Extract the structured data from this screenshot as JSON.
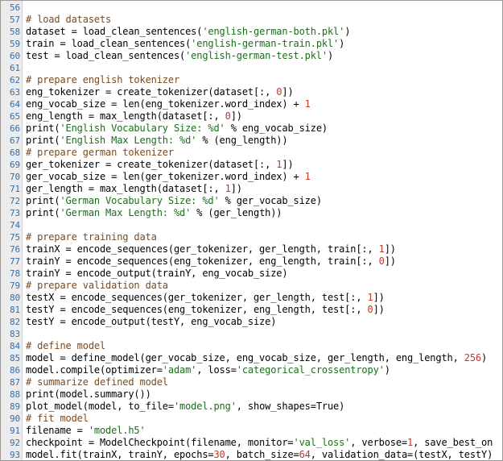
{
  "editor": {
    "lines": [
      {
        "no": "56",
        "tokens": []
      },
      {
        "no": "57",
        "tokens": [
          {
            "t": "# load datasets",
            "k": "c"
          }
        ]
      },
      {
        "no": "58",
        "tokens": [
          {
            "t": "dataset = load_clean_sentences(",
            "k": "p"
          },
          {
            "t": "'english-german-both.pkl'",
            "k": "s"
          },
          {
            "t": ")",
            "k": "p"
          }
        ]
      },
      {
        "no": "59",
        "tokens": [
          {
            "t": "train = load_clean_sentences(",
            "k": "p"
          },
          {
            "t": "'english-german-train.pkl'",
            "k": "s"
          },
          {
            "t": ")",
            "k": "p"
          }
        ]
      },
      {
        "no": "60",
        "tokens": [
          {
            "t": "test = load_clean_sentences(",
            "k": "p"
          },
          {
            "t": "'english-german-test.pkl'",
            "k": "s"
          },
          {
            "t": ")",
            "k": "p"
          }
        ]
      },
      {
        "no": "61",
        "tokens": []
      },
      {
        "no": "62",
        "tokens": [
          {
            "t": "# prepare english tokenizer",
            "k": "c"
          }
        ]
      },
      {
        "no": "63",
        "tokens": [
          {
            "t": "eng_tokenizer = create_tokenizer(dataset[:, ",
            "k": "p"
          },
          {
            "t": "0",
            "k": "n"
          },
          {
            "t": "])",
            "k": "p"
          }
        ]
      },
      {
        "no": "64",
        "tokens": [
          {
            "t": "eng_vocab_size = len(eng_tokenizer.word_index) + ",
            "k": "p"
          },
          {
            "t": "1",
            "k": "n"
          }
        ]
      },
      {
        "no": "65",
        "tokens": [
          {
            "t": "eng_length = max_length(dataset[:, ",
            "k": "p"
          },
          {
            "t": "0",
            "k": "n"
          },
          {
            "t": "])",
            "k": "p"
          }
        ]
      },
      {
        "no": "66",
        "tokens": [
          {
            "t": "print(",
            "k": "p"
          },
          {
            "t": "'English Vocabulary Size: %d'",
            "k": "s"
          },
          {
            "t": " % eng_vocab_size)",
            "k": "p"
          }
        ]
      },
      {
        "no": "67",
        "tokens": [
          {
            "t": "print(",
            "k": "p"
          },
          {
            "t": "'English Max Length: %d'",
            "k": "s"
          },
          {
            "t": " % (eng_length))",
            "k": "p"
          }
        ]
      },
      {
        "no": "68",
        "tokens": [
          {
            "t": "# prepare german tokenizer",
            "k": "c"
          }
        ]
      },
      {
        "no": "69",
        "tokens": [
          {
            "t": "ger_tokenizer = create_tokenizer(dataset[:, ",
            "k": "p"
          },
          {
            "t": "1",
            "k": "n"
          },
          {
            "t": "])",
            "k": "p"
          }
        ]
      },
      {
        "no": "70",
        "tokens": [
          {
            "t": "ger_vocab_size = len(ger_tokenizer.word_index) + ",
            "k": "p"
          },
          {
            "t": "1",
            "k": "n"
          }
        ]
      },
      {
        "no": "71",
        "tokens": [
          {
            "t": "ger_length = max_length(dataset[:, ",
            "k": "p"
          },
          {
            "t": "1",
            "k": "n"
          },
          {
            "t": "])",
            "k": "p"
          }
        ]
      },
      {
        "no": "72",
        "tokens": [
          {
            "t": "print(",
            "k": "p"
          },
          {
            "t": "'German Vocabulary Size: %d'",
            "k": "s"
          },
          {
            "t": " % ger_vocab_size)",
            "k": "p"
          }
        ]
      },
      {
        "no": "73",
        "tokens": [
          {
            "t": "print(",
            "k": "p"
          },
          {
            "t": "'German Max Length: %d'",
            "k": "s"
          },
          {
            "t": " % (ger_length))",
            "k": "p"
          }
        ]
      },
      {
        "no": "74",
        "tokens": []
      },
      {
        "no": "75",
        "tokens": [
          {
            "t": "# prepare training data",
            "k": "c"
          }
        ]
      },
      {
        "no": "76",
        "tokens": [
          {
            "t": "trainX = encode_sequences(ger_tokenizer, ger_length, train[:, ",
            "k": "p"
          },
          {
            "t": "1",
            "k": "n"
          },
          {
            "t": "])",
            "k": "p"
          }
        ]
      },
      {
        "no": "77",
        "tokens": [
          {
            "t": "trainY = encode_sequences(eng_tokenizer, eng_length, train[:, ",
            "k": "p"
          },
          {
            "t": "0",
            "k": "n"
          },
          {
            "t": "])",
            "k": "p"
          }
        ]
      },
      {
        "no": "78",
        "tokens": [
          {
            "t": "trainY = encode_output(trainY, eng_vocab_size)",
            "k": "p"
          }
        ]
      },
      {
        "no": "79",
        "tokens": [
          {
            "t": "# prepare validation data",
            "k": "c"
          }
        ]
      },
      {
        "no": "80",
        "tokens": [
          {
            "t": "testX = encode_sequences(ger_tokenizer, ger_length, test[:, ",
            "k": "p"
          },
          {
            "t": "1",
            "k": "n"
          },
          {
            "t": "])",
            "k": "p"
          }
        ]
      },
      {
        "no": "81",
        "tokens": [
          {
            "t": "testY = encode_sequences(eng_tokenizer, eng_length, test[:, ",
            "k": "p"
          },
          {
            "t": "0",
            "k": "n"
          },
          {
            "t": "])",
            "k": "p"
          }
        ]
      },
      {
        "no": "82",
        "tokens": [
          {
            "t": "testY = encode_output(testY, eng_vocab_size)",
            "k": "p"
          }
        ]
      },
      {
        "no": "83",
        "tokens": []
      },
      {
        "no": "84",
        "tokens": [
          {
            "t": "# define model",
            "k": "c"
          }
        ]
      },
      {
        "no": "85",
        "tokens": [
          {
            "t": "model = define_model(ger_vocab_size, eng_vocab_size, ger_length, eng_length, ",
            "k": "p"
          },
          {
            "t": "256",
            "k": "n"
          },
          {
            "t": ")",
            "k": "p"
          }
        ]
      },
      {
        "no": "86",
        "tokens": [
          {
            "t": "model.compile(optimizer=",
            "k": "p"
          },
          {
            "t": "'adam'",
            "k": "s"
          },
          {
            "t": ", loss=",
            "k": "p"
          },
          {
            "t": "'categorical_crossentropy'",
            "k": "s"
          },
          {
            "t": ")",
            "k": "p"
          }
        ]
      },
      {
        "no": "87",
        "tokens": [
          {
            "t": "# summarize defined model",
            "k": "c"
          }
        ]
      },
      {
        "no": "88",
        "tokens": [
          {
            "t": "print(model.summary())",
            "k": "p"
          }
        ]
      },
      {
        "no": "89",
        "tokens": [
          {
            "t": "plot_model(model, to_file=",
            "k": "p"
          },
          {
            "t": "'model.png'",
            "k": "s"
          },
          {
            "t": ", show_shapes=True)",
            "k": "p"
          }
        ]
      },
      {
        "no": "90",
        "tokens": [
          {
            "t": "# fit model",
            "k": "c"
          }
        ]
      },
      {
        "no": "91",
        "tokens": [
          {
            "t": "filename = ",
            "k": "p"
          },
          {
            "t": "'model.h5'",
            "k": "s"
          }
        ]
      },
      {
        "no": "92",
        "tokens": [
          {
            "t": "checkpoint = ModelCheckpoint(filename, monitor=",
            "k": "p"
          },
          {
            "t": "'val_loss'",
            "k": "s"
          },
          {
            "t": ", verbose=",
            "k": "p"
          },
          {
            "t": "1",
            "k": "n"
          },
          {
            "t": ", save_best_on",
            "k": "p"
          }
        ]
      },
      {
        "no": "93",
        "tokens": [
          {
            "t": "model.fit(trainX, trainY, epochs=",
            "k": "p"
          },
          {
            "t": "30",
            "k": "n"
          },
          {
            "t": ", batch_size=",
            "k": "p"
          },
          {
            "t": "64",
            "k": "n"
          },
          {
            "t": ", validation_data=(testX, testY)",
            "k": "p"
          }
        ]
      }
    ]
  }
}
